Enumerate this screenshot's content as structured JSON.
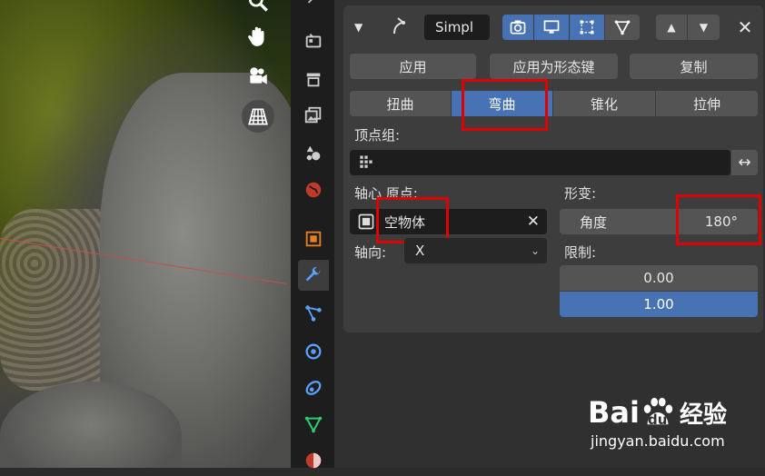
{
  "viewport": {
    "tools": [
      "hand-icon",
      "camera-icon",
      "grid-icon"
    ]
  },
  "header": {
    "modifier_name": "Simpl"
  },
  "actions": {
    "apply": "应用",
    "apply_shape_key": "应用为形态键",
    "copy": "复制"
  },
  "deform_modes": [
    {
      "label": "扭曲",
      "selected": false
    },
    {
      "label": "弯曲",
      "selected": true
    },
    {
      "label": "锥化",
      "selected": false
    },
    {
      "label": "拉伸",
      "selected": false
    }
  ],
  "vertex_group": {
    "label": "顶点组:",
    "value": ""
  },
  "origin": {
    "label": "轴心 原点:",
    "value": "空物体"
  },
  "axis": {
    "label": "轴向:",
    "value": "X"
  },
  "deform": {
    "label": "形变:",
    "angle_label": "角度",
    "angle_value": "180°"
  },
  "limits": {
    "label": "限制:",
    "min": "0.00",
    "max": "1.00"
  },
  "watermark": {
    "brand_a": "Bai",
    "brand_b": "du",
    "brand_cn": "经验",
    "url": "jingyan.baidu.com"
  },
  "colors": {
    "selected": "#4772b3",
    "highlight": "#e00000"
  }
}
